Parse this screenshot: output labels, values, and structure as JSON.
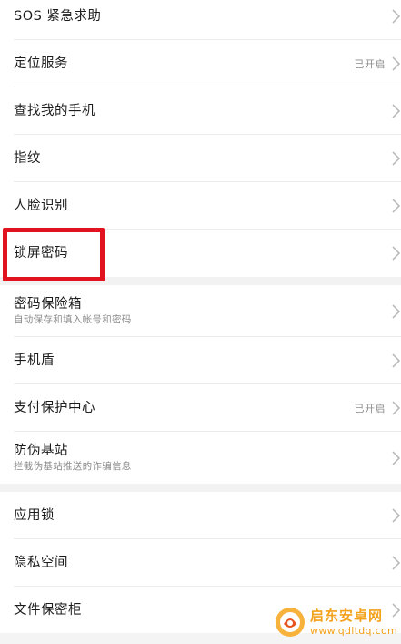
{
  "group1": [
    {
      "label": "SOS 紧急求助",
      "status": ""
    },
    {
      "label": "定位服务",
      "status": "已开启"
    },
    {
      "label": "查找我的手机",
      "status": ""
    },
    {
      "label": "指纹",
      "status": ""
    },
    {
      "label": "人脸识别",
      "status": ""
    },
    {
      "label": "锁屏密码",
      "status": ""
    }
  ],
  "group2": [
    {
      "label": "密码保险箱",
      "sublabel": "自动保存和填入帐号和密码",
      "status": ""
    },
    {
      "label": "手机盾",
      "status": ""
    },
    {
      "label": "支付保护中心",
      "status": "已开启"
    },
    {
      "label": "防伪基站",
      "sublabel": "拦截伪基站推送的诈骗信息",
      "status": ""
    }
  ],
  "group3": [
    {
      "label": "应用锁",
      "status": ""
    },
    {
      "label": "隐私空间",
      "status": ""
    },
    {
      "label": "文件保密柜",
      "status": ""
    }
  ],
  "watermark": {
    "title": "启东安卓网",
    "url": "www.qdltdq.com"
  },
  "colors": {
    "highlight": "#e0131e",
    "watermark": "#f4a21c"
  }
}
